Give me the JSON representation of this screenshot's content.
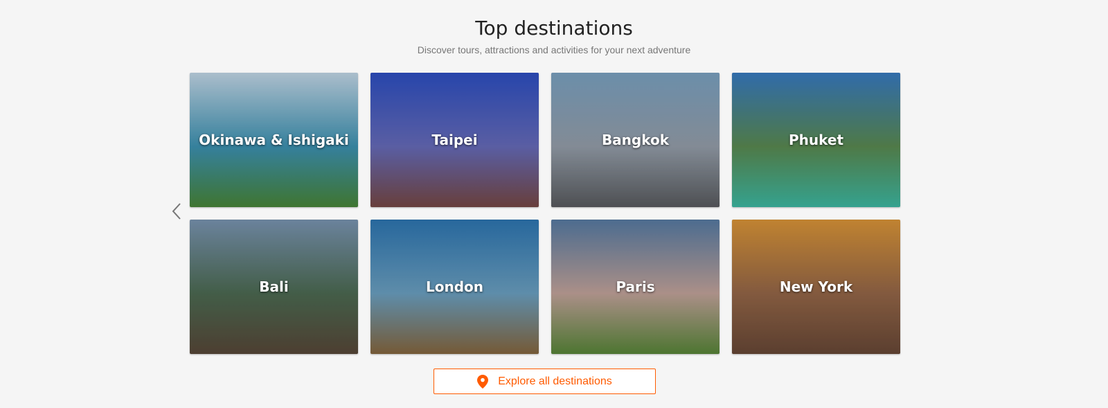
{
  "header": {
    "title": "Top destinations",
    "subtitle": "Discover tours, attractions and activities for your next adventure"
  },
  "destinations": [
    {
      "name": "Okinawa & Ishigaki",
      "colors": [
        "#c9dff0",
        "#3f97b8",
        "#4a8a3a"
      ]
    },
    {
      "name": "Taipei",
      "colors": [
        "#2f52c9",
        "#6a6fc0",
        "#7a4a46"
      ]
    },
    {
      "name": "Bangkok",
      "colors": [
        "#7fa7c8",
        "#9aa4b0",
        "#5c5e62"
      ]
    },
    {
      "name": "Phuket",
      "colors": [
        "#3a7fc8",
        "#5d8f54",
        "#3fbfa8"
      ]
    },
    {
      "name": "Bali",
      "colors": [
        "#7e9ab8",
        "#4f6e55",
        "#5b4a3a"
      ]
    },
    {
      "name": "London",
      "colors": [
        "#2f7ab8",
        "#6fa6c8",
        "#8a6a40"
      ]
    },
    {
      "name": "Paris",
      "colors": [
        "#5a7fa8",
        "#c9a9a0",
        "#5b8a3a"
      ]
    },
    {
      "name": "New York",
      "colors": [
        "#e29a3a",
        "#9a6a4a",
        "#6b4a38"
      ]
    }
  ],
  "navigation": {
    "prev_icon": "chevron-left-icon"
  },
  "explore": {
    "label": "Explore all destinations",
    "icon": "map-pin-icon",
    "accent": "#ff5b00"
  }
}
